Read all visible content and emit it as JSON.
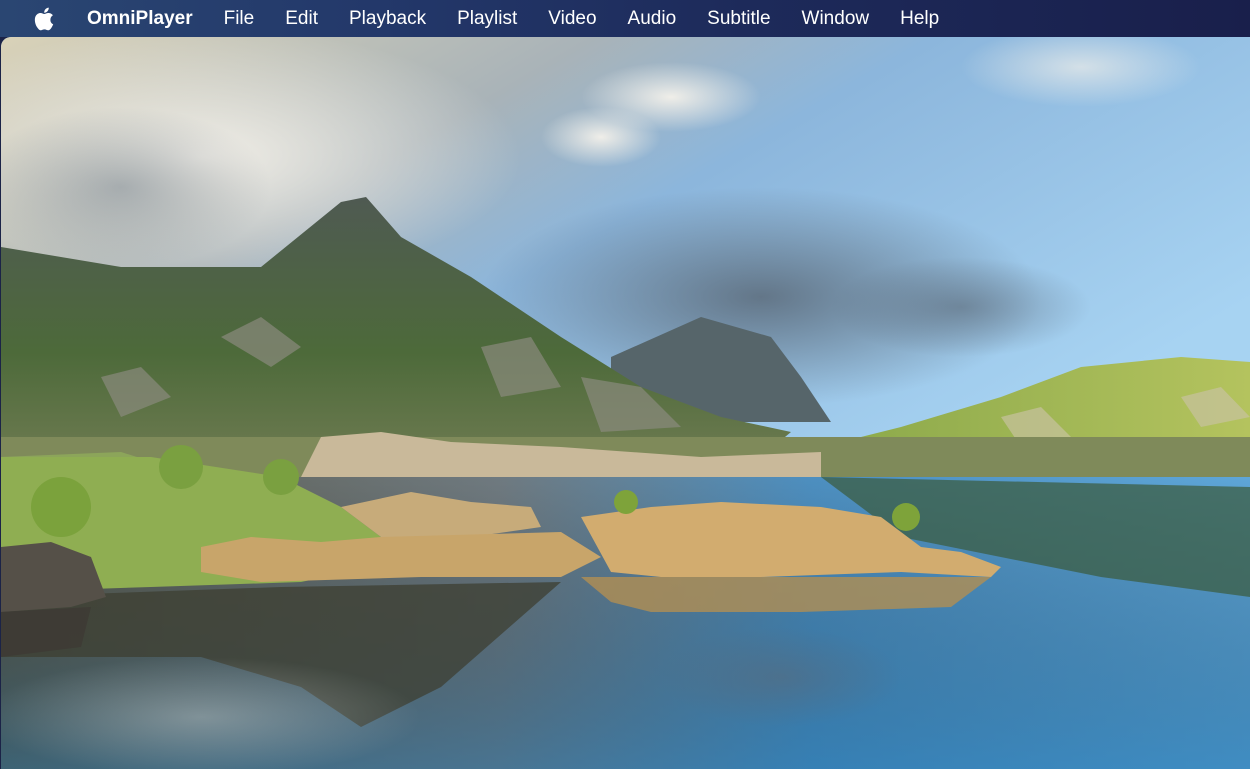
{
  "menubar": {
    "apple_icon": "apple-logo-icon",
    "app_name": "OmniPlayer",
    "items": [
      "File",
      "Edit",
      "Playback",
      "Playlist",
      "Video",
      "Audio",
      "Subtitle",
      "Window",
      "Help"
    ]
  },
  "video": {
    "scene": "Mountain lake landscape with clouds, rocks and reflections"
  }
}
